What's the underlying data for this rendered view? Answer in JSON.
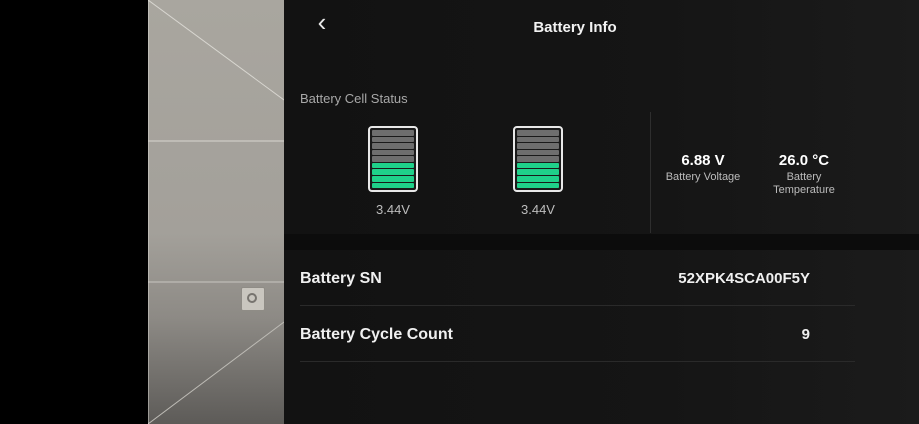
{
  "header": {
    "title": "Battery Info",
    "back_icon": "chevron-left-icon"
  },
  "cell_status": {
    "label": "Battery Cell Status",
    "cells": [
      {
        "voltage": "3.44V",
        "level_fraction": 0.4
      },
      {
        "voltage": "3.44V",
        "level_fraction": 0.4
      }
    ],
    "segments_per_cell": 9,
    "filled_segments": 4,
    "fill_color": "#1fd18a"
  },
  "stats": {
    "voltage": {
      "value": "6.88 V",
      "label": "Battery Voltage"
    },
    "temperature": {
      "value": "26.0 °C",
      "label_line1": "Battery",
      "label_line2": "Temperature"
    }
  },
  "rows": [
    {
      "key": "Battery SN",
      "value": "52XPK4SCA00F5Y"
    },
    {
      "key": "Battery Cycle Count",
      "value": "9"
    }
  ]
}
